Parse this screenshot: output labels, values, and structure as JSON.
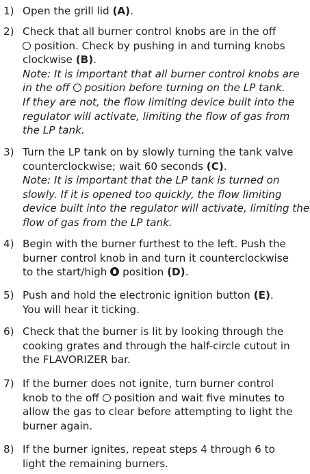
{
  "steps": [
    {
      "num": "1)",
      "lines": [
        {
          "segments": [
            {
              "t": "Open the grill lid "
            },
            {
              "t": "(A)",
              "b": true
            },
            {
              "t": "."
            }
          ]
        }
      ]
    },
    {
      "num": "2)",
      "lines": [
        {
          "segments": [
            {
              "t": "Check that all burner control knobs are in the off"
            }
          ]
        },
        {
          "segments": [
            {
              "sym": "off"
            },
            {
              "t": " position. Check by pushing in and turning knobs"
            }
          ]
        },
        {
          "segments": [
            {
              "t": "clockwise "
            },
            {
              "t": "(B)",
              "b": true
            },
            {
              "t": "."
            }
          ]
        },
        {
          "note": true,
          "segments": [
            {
              "t": "Note: It is important that all burner control knobs are"
            }
          ]
        },
        {
          "note": true,
          "segments": [
            {
              "t": "in the off "
            },
            {
              "sym": "off"
            },
            {
              "t": " position before turning on the LP tank."
            }
          ]
        },
        {
          "note": true,
          "segments": [
            {
              "t": "If they are not, the flow limiting device built into the"
            }
          ]
        },
        {
          "note": true,
          "segments": [
            {
              "t": "regulator will activate, limiting the flow of gas from"
            }
          ]
        },
        {
          "note": true,
          "segments": [
            {
              "t": "the LP tank."
            }
          ]
        }
      ]
    },
    {
      "num": "3)",
      "lines": [
        {
          "segments": [
            {
              "t": "Turn the LP tank on by slowly turning the tank valve"
            }
          ]
        },
        {
          "segments": [
            {
              "t": "counterclockwise; wait 60 seconds "
            },
            {
              "t": "(C)",
              "b": true
            },
            {
              "t": "."
            }
          ]
        },
        {
          "note": true,
          "segments": [
            {
              "t": "Note: It is important that the LP tank is turned on"
            }
          ]
        },
        {
          "note": true,
          "segments": [
            {
              "t": "slowly. If it is opened too quickly, the flow limiting"
            }
          ]
        },
        {
          "note": true,
          "segments": [
            {
              "t": "device built into the regulator will activate, limiting the"
            }
          ]
        },
        {
          "note": true,
          "segments": [
            {
              "t": "flow of gas from the LP tank."
            }
          ]
        }
      ]
    },
    {
      "num": "4)",
      "lines": [
        {
          "segments": [
            {
              "t": "Begin with the burner furthest to the left. Push the"
            }
          ]
        },
        {
          "segments": [
            {
              "t": "burner control knob in and turn it counterclockwise"
            }
          ]
        },
        {
          "segments": [
            {
              "t": "to the start/high "
            },
            {
              "sym": "flame"
            },
            {
              "t": " position "
            },
            {
              "t": "(D)",
              "b": true
            },
            {
              "t": "."
            }
          ]
        }
      ]
    },
    {
      "num": "5)",
      "lines": [
        {
          "segments": [
            {
              "t": "Push and hold the electronic ignition button "
            },
            {
              "t": "(E)",
              "b": true
            },
            {
              "t": "."
            }
          ]
        },
        {
          "segments": [
            {
              "t": "You will hear it ticking."
            }
          ]
        }
      ]
    },
    {
      "num": "6)",
      "lines": [
        {
          "segments": [
            {
              "t": "Check that the burner is lit by looking through the"
            }
          ]
        },
        {
          "segments": [
            {
              "t": "cooking grates and through the half-circle cutout in"
            }
          ]
        },
        {
          "segments": [
            {
              "t": "the FLAVORIZER bar."
            }
          ]
        }
      ]
    },
    {
      "num": "7)",
      "lines": [
        {
          "segments": [
            {
              "t": "If the burner does not ignite, turn burner control"
            }
          ]
        },
        {
          "segments": [
            {
              "t": "knob to the off "
            },
            {
              "sym": "off"
            },
            {
              "t": " position and wait five minutes to"
            }
          ]
        },
        {
          "segments": [
            {
              "t": "allow the gas to clear before attempting to light the"
            }
          ]
        },
        {
          "segments": [
            {
              "t": "burner again."
            }
          ]
        }
      ]
    },
    {
      "num": "8)",
      "lines": [
        {
          "segments": [
            {
              "t": "If the burner ignites, repeat steps 4 through 6 to"
            }
          ]
        },
        {
          "segments": [
            {
              "t": "light the remaining burners."
            }
          ]
        }
      ]
    }
  ]
}
